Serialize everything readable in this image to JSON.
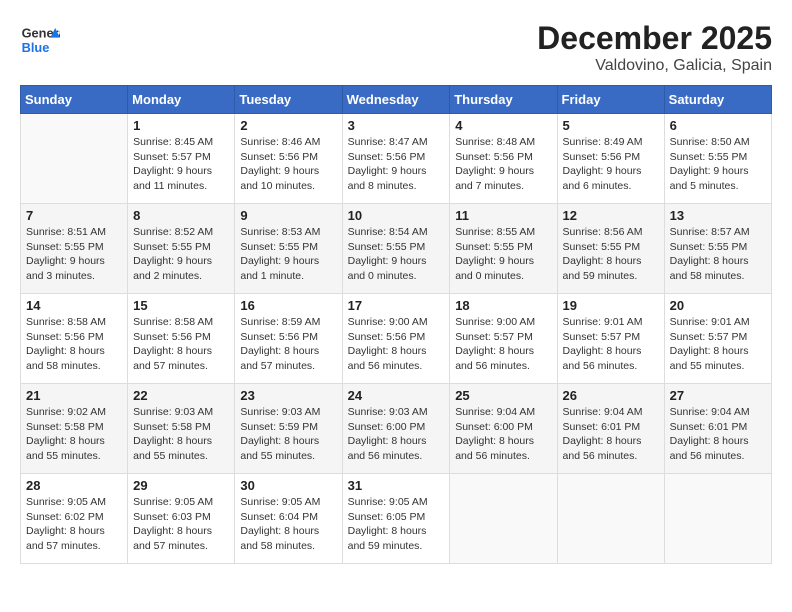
{
  "header": {
    "logo_line1": "General",
    "logo_line2": "Blue",
    "month": "December 2025",
    "location": "Valdovino, Galicia, Spain"
  },
  "weekdays": [
    "Sunday",
    "Monday",
    "Tuesday",
    "Wednesday",
    "Thursday",
    "Friday",
    "Saturday"
  ],
  "weeks": [
    [
      {
        "day": "",
        "info": ""
      },
      {
        "day": "1",
        "info": "Sunrise: 8:45 AM\nSunset: 5:57 PM\nDaylight: 9 hours\nand 11 minutes."
      },
      {
        "day": "2",
        "info": "Sunrise: 8:46 AM\nSunset: 5:56 PM\nDaylight: 9 hours\nand 10 minutes."
      },
      {
        "day": "3",
        "info": "Sunrise: 8:47 AM\nSunset: 5:56 PM\nDaylight: 9 hours\nand 8 minutes."
      },
      {
        "day": "4",
        "info": "Sunrise: 8:48 AM\nSunset: 5:56 PM\nDaylight: 9 hours\nand 7 minutes."
      },
      {
        "day": "5",
        "info": "Sunrise: 8:49 AM\nSunset: 5:56 PM\nDaylight: 9 hours\nand 6 minutes."
      },
      {
        "day": "6",
        "info": "Sunrise: 8:50 AM\nSunset: 5:55 PM\nDaylight: 9 hours\nand 5 minutes."
      }
    ],
    [
      {
        "day": "7",
        "info": "Sunrise: 8:51 AM\nSunset: 5:55 PM\nDaylight: 9 hours\nand 3 minutes."
      },
      {
        "day": "8",
        "info": "Sunrise: 8:52 AM\nSunset: 5:55 PM\nDaylight: 9 hours\nand 2 minutes."
      },
      {
        "day": "9",
        "info": "Sunrise: 8:53 AM\nSunset: 5:55 PM\nDaylight: 9 hours\nand 1 minute."
      },
      {
        "day": "10",
        "info": "Sunrise: 8:54 AM\nSunset: 5:55 PM\nDaylight: 9 hours\nand 0 minutes."
      },
      {
        "day": "11",
        "info": "Sunrise: 8:55 AM\nSunset: 5:55 PM\nDaylight: 9 hours\nand 0 minutes."
      },
      {
        "day": "12",
        "info": "Sunrise: 8:56 AM\nSunset: 5:55 PM\nDaylight: 8 hours\nand 59 minutes."
      },
      {
        "day": "13",
        "info": "Sunrise: 8:57 AM\nSunset: 5:55 PM\nDaylight: 8 hours\nand 58 minutes."
      }
    ],
    [
      {
        "day": "14",
        "info": "Sunrise: 8:58 AM\nSunset: 5:56 PM\nDaylight: 8 hours\nand 58 minutes."
      },
      {
        "day": "15",
        "info": "Sunrise: 8:58 AM\nSunset: 5:56 PM\nDaylight: 8 hours\nand 57 minutes."
      },
      {
        "day": "16",
        "info": "Sunrise: 8:59 AM\nSunset: 5:56 PM\nDaylight: 8 hours\nand 57 minutes."
      },
      {
        "day": "17",
        "info": "Sunrise: 9:00 AM\nSunset: 5:56 PM\nDaylight: 8 hours\nand 56 minutes."
      },
      {
        "day": "18",
        "info": "Sunrise: 9:00 AM\nSunset: 5:57 PM\nDaylight: 8 hours\nand 56 minutes."
      },
      {
        "day": "19",
        "info": "Sunrise: 9:01 AM\nSunset: 5:57 PM\nDaylight: 8 hours\nand 56 minutes."
      },
      {
        "day": "20",
        "info": "Sunrise: 9:01 AM\nSunset: 5:57 PM\nDaylight: 8 hours\nand 55 minutes."
      }
    ],
    [
      {
        "day": "21",
        "info": "Sunrise: 9:02 AM\nSunset: 5:58 PM\nDaylight: 8 hours\nand 55 minutes."
      },
      {
        "day": "22",
        "info": "Sunrise: 9:03 AM\nSunset: 5:58 PM\nDaylight: 8 hours\nand 55 minutes."
      },
      {
        "day": "23",
        "info": "Sunrise: 9:03 AM\nSunset: 5:59 PM\nDaylight: 8 hours\nand 55 minutes."
      },
      {
        "day": "24",
        "info": "Sunrise: 9:03 AM\nSunset: 6:00 PM\nDaylight: 8 hours\nand 56 minutes."
      },
      {
        "day": "25",
        "info": "Sunrise: 9:04 AM\nSunset: 6:00 PM\nDaylight: 8 hours\nand 56 minutes."
      },
      {
        "day": "26",
        "info": "Sunrise: 9:04 AM\nSunset: 6:01 PM\nDaylight: 8 hours\nand 56 minutes."
      },
      {
        "day": "27",
        "info": "Sunrise: 9:04 AM\nSunset: 6:01 PM\nDaylight: 8 hours\nand 56 minutes."
      }
    ],
    [
      {
        "day": "28",
        "info": "Sunrise: 9:05 AM\nSunset: 6:02 PM\nDaylight: 8 hours\nand 57 minutes."
      },
      {
        "day": "29",
        "info": "Sunrise: 9:05 AM\nSunset: 6:03 PM\nDaylight: 8 hours\nand 57 minutes."
      },
      {
        "day": "30",
        "info": "Sunrise: 9:05 AM\nSunset: 6:04 PM\nDaylight: 8 hours\nand 58 minutes."
      },
      {
        "day": "31",
        "info": "Sunrise: 9:05 AM\nSunset: 6:05 PM\nDaylight: 8 hours\nand 59 minutes."
      },
      {
        "day": "",
        "info": ""
      },
      {
        "day": "",
        "info": ""
      },
      {
        "day": "",
        "info": ""
      }
    ]
  ]
}
